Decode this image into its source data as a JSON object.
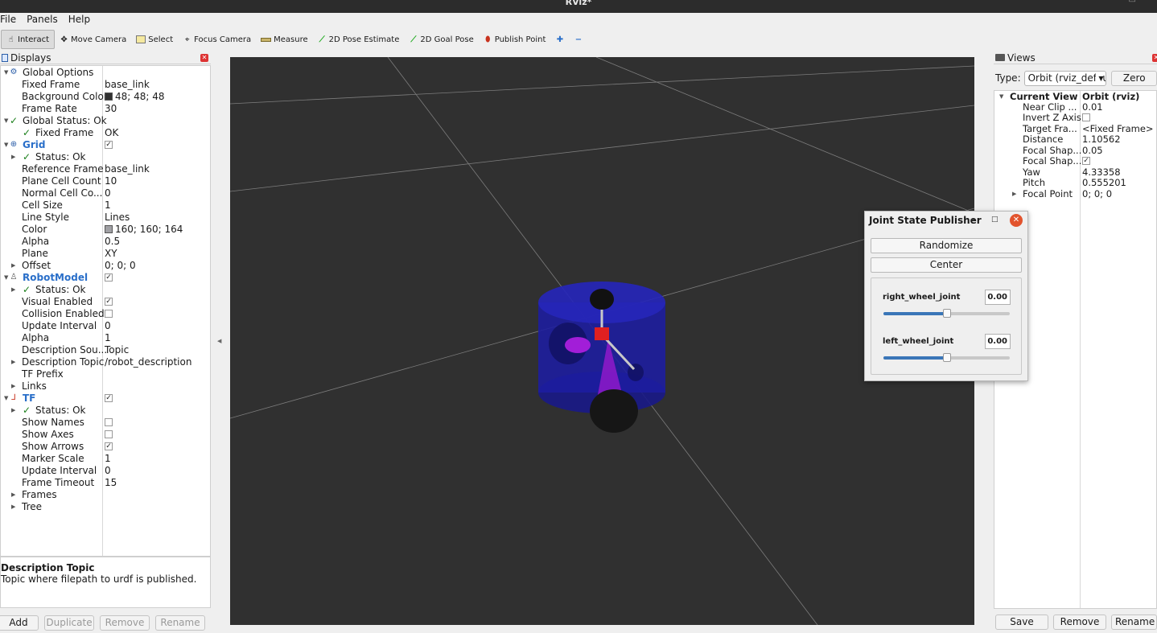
{
  "window": {
    "title": "RViz*"
  },
  "menu": {
    "file": "File",
    "panels": "Panels",
    "help": "Help"
  },
  "toolbar": {
    "interact": "Interact",
    "move_camera": "Move Camera",
    "select": "Select",
    "focus_camera": "Focus Camera",
    "measure": "Measure",
    "pose_estimate": "2D Pose Estimate",
    "goal_pose": "2D Goal Pose",
    "publish_point": "Publish Point"
  },
  "displays": {
    "title": "Displays",
    "rows": [
      {
        "name": "Global Options",
        "value": ""
      },
      {
        "name": "Fixed Frame",
        "value": "base_link"
      },
      {
        "name": "Background Color",
        "value": "48; 48; 48",
        "swatch": "#303030"
      },
      {
        "name": "Frame Rate",
        "value": "30"
      },
      {
        "name": "Global Status: Ok",
        "value": ""
      },
      {
        "name": "Fixed Frame",
        "value": "OK"
      },
      {
        "name": "Grid",
        "value": ""
      },
      {
        "name": "Status: Ok",
        "value": ""
      },
      {
        "name": "Reference Frame",
        "value": "base_link"
      },
      {
        "name": "Plane Cell Count",
        "value": "10"
      },
      {
        "name": "Normal Cell Co...",
        "value": "0"
      },
      {
        "name": "Cell Size",
        "value": "1"
      },
      {
        "name": "Line Style",
        "value": "Lines"
      },
      {
        "name": "Color",
        "value": "160; 160; 164",
        "swatch": "#a0a0a4"
      },
      {
        "name": "Alpha",
        "value": "0.5"
      },
      {
        "name": "Plane",
        "value": "XY"
      },
      {
        "name": "Offset",
        "value": "0; 0; 0"
      },
      {
        "name": "RobotModel",
        "value": ""
      },
      {
        "name": "Status: Ok",
        "value": ""
      },
      {
        "name": "Visual Enabled",
        "value": ""
      },
      {
        "name": "Collision Enabled",
        "value": ""
      },
      {
        "name": "Update Interval",
        "value": "0"
      },
      {
        "name": "Alpha",
        "value": "1"
      },
      {
        "name": "Description Sou...",
        "value": "Topic"
      },
      {
        "name": "Description Topic",
        "value": "/robot_description"
      },
      {
        "name": "TF Prefix",
        "value": ""
      },
      {
        "name": "Links",
        "value": ""
      },
      {
        "name": "TF",
        "value": ""
      },
      {
        "name": "Status: Ok",
        "value": ""
      },
      {
        "name": "Show Names",
        "value": ""
      },
      {
        "name": "Show Axes",
        "value": ""
      },
      {
        "name": "Show Arrows",
        "value": ""
      },
      {
        "name": "Marker Scale",
        "value": "1"
      },
      {
        "name": "Update Interval",
        "value": "0"
      },
      {
        "name": "Frame Timeout",
        "value": "15"
      },
      {
        "name": "Frames",
        "value": ""
      },
      {
        "name": "Tree",
        "value": ""
      }
    ],
    "checks": {
      "grid": true,
      "robot_model": true,
      "visual_enabled": true,
      "collision_enabled": false,
      "tf": true,
      "show_names": false,
      "show_axes": false,
      "show_arrows": true
    },
    "description": {
      "title": "Description Topic",
      "body": "Topic where filepath to urdf is published."
    },
    "buttons": {
      "add": "Add",
      "duplicate": "Duplicate",
      "remove": "Remove",
      "rename": "Rename"
    }
  },
  "views": {
    "title": "Views",
    "type_label": "Type:",
    "type_value": "Orbit (rviz_default_plugins)",
    "zero": "Zero",
    "current_view": "Current View",
    "current_view_value": "Orbit (rviz)",
    "rows": [
      {
        "name": "Near Clip ...",
        "value": "0.01"
      },
      {
        "name": "Invert Z Axis",
        "value": ""
      },
      {
        "name": "Target Fra...",
        "value": "<Fixed Frame>"
      },
      {
        "name": "Distance",
        "value": "1.10562"
      },
      {
        "name": "Focal Shap...",
        "value": "0.05"
      },
      {
        "name": "Focal Shap...",
        "value": ""
      },
      {
        "name": "Yaw",
        "value": "4.33358"
      },
      {
        "name": "Pitch",
        "value": "0.555201"
      },
      {
        "name": "Focal Point",
        "value": "0; 0; 0"
      }
    ],
    "checks": {
      "invert_z": false,
      "focal_shape_fixed": true
    },
    "buttons": {
      "save": "Save",
      "remove": "Remove",
      "rename": "Rename"
    }
  },
  "joint_state_publisher": {
    "title": "Joint State Publisher",
    "randomize": "Randomize",
    "center": "Center",
    "joints": [
      {
        "name": "right_wheel_joint",
        "value": "0.00",
        "position": 0.5
      },
      {
        "name": "left_wheel_joint",
        "value": "0.00",
        "position": 0.5
      }
    ]
  },
  "colors": {
    "viewport_bg": "#303030",
    "accent": "#2a6fc9",
    "status_ok": "#1a7f1a",
    "close_red": "#e2532d"
  }
}
